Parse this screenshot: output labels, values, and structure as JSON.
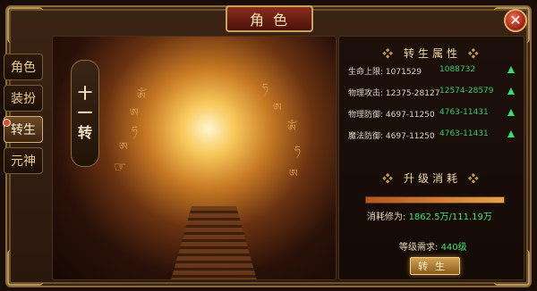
{
  "window": {
    "title": "角色"
  },
  "tabs": [
    {
      "label": "角色",
      "active": false
    },
    {
      "label": "装扮",
      "active": false
    },
    {
      "label": "转生",
      "active": true,
      "badge": true
    },
    {
      "label": "元神",
      "active": false
    }
  ],
  "art": {
    "rebirth_level": [
      "十",
      "一",
      "转"
    ]
  },
  "attributes": {
    "title": "转生属性",
    "rows": [
      {
        "label": "生命上限:",
        "current": "1071529",
        "next": "1088732"
      },
      {
        "label": "物理攻击:",
        "current": "12375-28127",
        "next": "12574-28579"
      },
      {
        "label": "物理防御:",
        "current": "4697-11250",
        "next": "4763-11431"
      },
      {
        "label": "魔法防御:",
        "current": "4697-11250",
        "next": "4763-11431"
      }
    ]
  },
  "upgrade": {
    "title": "升级消耗",
    "progress": 1.0,
    "consume_label": "消耗修为:",
    "consume_value": "1862.5万/111.19万",
    "level_label": "等级需求:",
    "level_value": "440级",
    "button_label": "转生"
  },
  "colors": {
    "accent_green": "#45e36d",
    "frame_gold": "#b4945a",
    "title_red": "#8a2d1c"
  }
}
